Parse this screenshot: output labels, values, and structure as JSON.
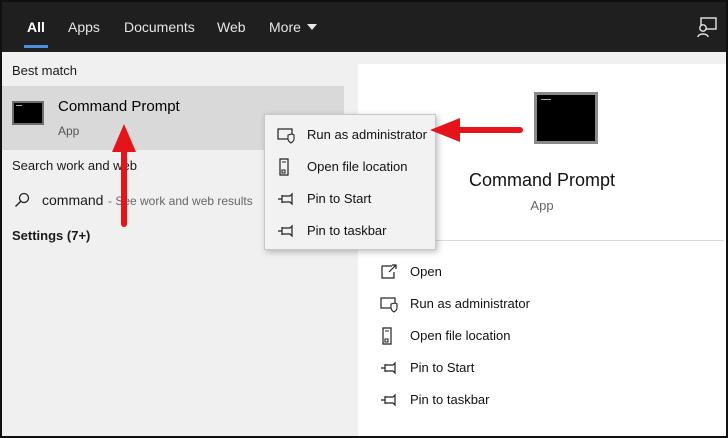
{
  "tabs": [
    {
      "label": "All",
      "active": true
    },
    {
      "label": "Apps"
    },
    {
      "label": "Documents"
    },
    {
      "label": "Web"
    },
    {
      "label": "More"
    }
  ],
  "left": {
    "best_match_heading": "Best match",
    "best_match": {
      "title": "Command Prompt",
      "subtitle": "App"
    },
    "search_heading": "Search work and web",
    "search_term": "command",
    "search_hint": "- See work and web results",
    "settings_heading": "Settings (7+)"
  },
  "context_menu": [
    {
      "label": "Run as administrator",
      "icon": "shield-icon"
    },
    {
      "label": "Open file location",
      "icon": "file-location-icon"
    },
    {
      "label": "Pin to Start",
      "icon": "pin-icon"
    },
    {
      "label": "Pin to taskbar",
      "icon": "pin-icon"
    }
  ],
  "right": {
    "title": "Command Prompt",
    "subtitle": "App",
    "actions": [
      {
        "label": "Open",
        "icon": "open-icon"
      },
      {
        "label": "Run as administrator",
        "icon": "shield-icon"
      },
      {
        "label": "Open file location",
        "icon": "file-location-icon"
      },
      {
        "label": "Pin to Start",
        "icon": "pin-icon"
      },
      {
        "label": "Pin to taskbar",
        "icon": "pin-icon"
      }
    ]
  },
  "colors": {
    "accent": "#4c8ee0",
    "annotation_arrow": "#e5141b",
    "topbar": "#1f1f1f"
  }
}
